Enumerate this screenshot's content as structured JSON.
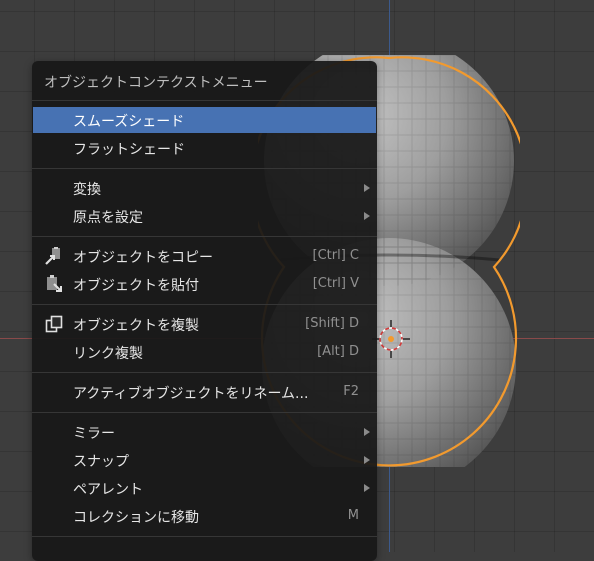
{
  "menu": {
    "title": "オブジェクトコンテクストメニュー",
    "items": [
      {
        "label": "スムーズシェード",
        "shortcut": "",
        "submenu": false,
        "active": true,
        "icon": ""
      },
      {
        "label": "フラットシェード",
        "shortcut": "",
        "submenu": false,
        "active": false,
        "icon": ""
      },
      {
        "label": "変換",
        "shortcut": "",
        "submenu": true,
        "active": false,
        "icon": ""
      },
      {
        "label": "原点を設定",
        "shortcut": "",
        "submenu": true,
        "active": false,
        "icon": ""
      },
      {
        "label": "オブジェクトをコピー",
        "shortcut": "[Ctrl] C",
        "submenu": false,
        "active": false,
        "icon": "copy-icon"
      },
      {
        "label": "オブジェクトを貼付",
        "shortcut": "[Ctrl] V",
        "submenu": false,
        "active": false,
        "icon": "paste-icon"
      },
      {
        "label": "オブジェクトを複製",
        "shortcut": "[Shift] D",
        "submenu": false,
        "active": false,
        "icon": "duplicate-icon"
      },
      {
        "label": "リンク複製",
        "shortcut": "[Alt] D",
        "submenu": false,
        "active": false,
        "icon": ""
      },
      {
        "label": "アクティブオブジェクトをリネーム...",
        "shortcut": "F2",
        "submenu": false,
        "active": false,
        "icon": ""
      },
      {
        "label": "ミラー",
        "shortcut": "",
        "submenu": true,
        "active": false,
        "icon": ""
      },
      {
        "label": "スナップ",
        "shortcut": "",
        "submenu": true,
        "active": false,
        "icon": ""
      },
      {
        "label": "ペアレント",
        "shortcut": "",
        "submenu": true,
        "active": false,
        "icon": ""
      },
      {
        "label": "コレクションに移動",
        "shortcut": "M",
        "submenu": false,
        "active": false,
        "icon": ""
      }
    ]
  },
  "colors": {
    "highlight": "#4772b3",
    "selection_outline": "#f29a2e",
    "x_axis": "#8a4a4a",
    "y_axis": "#3c5a8c"
  }
}
